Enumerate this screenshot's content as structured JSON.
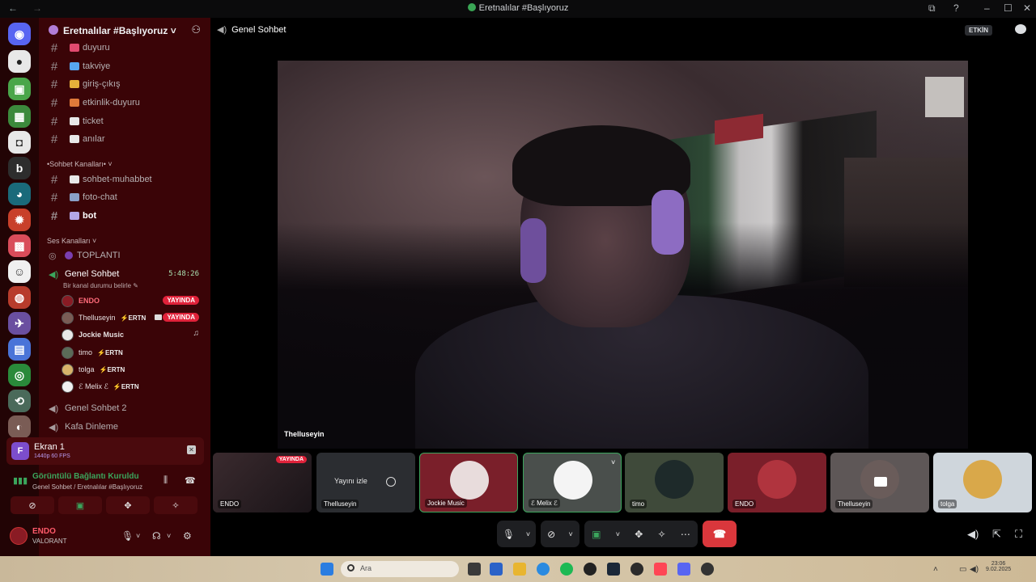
{
  "window": {
    "title": "Eretnalılar #Başlıyoruz"
  },
  "sidebar": {
    "guild_name": "Eretnalılar #Başlıyoruz ˅",
    "text_channels": [
      {
        "name": "duyuru",
        "emoji_color": "#e04a6e"
      },
      {
        "name": "takviye",
        "emoji_color": "#57a6f0"
      },
      {
        "name": "giriş-çıkış",
        "emoji_color": "#e6b03a"
      },
      {
        "name": "etkinlik-duyuru",
        "emoji_color": "#e07a3a"
      },
      {
        "name": "ticket",
        "emoji_color": "#e8e8e8"
      },
      {
        "name": "anılar",
        "emoji_color": "#e8e8e8"
      }
    ],
    "sohbet_category": "•Sohbet Kanalları• ˅",
    "sohbet_channels": [
      {
        "name": "sohbet-muhabbet",
        "emoji_color": "#e8e8e8"
      },
      {
        "name": "foto-chat",
        "emoji_color": "#8aa0c8"
      },
      {
        "name": "bot",
        "emoji_color": "#b3a6e6"
      }
    ],
    "voice_category": "Ses Kanalları ˅",
    "stage_channel": "TOPLANTI",
    "voice_channel": "Genel Sohbet",
    "voice_timer": "5:48:26",
    "voice_status": "Bir kanal durumu belirle ✎",
    "voice_users": [
      {
        "name": "ENDO",
        "tag": "",
        "live": "YAYINDA",
        "color": "#8a1b24"
      },
      {
        "name": "Thelluseyin",
        "tag": "⚡ERTN",
        "live": "YAYINDA",
        "color": "#7a5c55"
      },
      {
        "name": "Jockie Music",
        "tag": "",
        "live": "",
        "color": "#e8e8e8"
      },
      {
        "name": "timo",
        "tag": "⚡ERTN",
        "live": "",
        "color": "#5b6b57"
      },
      {
        "name": "tolga",
        "tag": "⚡ERTN",
        "live": "",
        "color": "#d8b36a"
      },
      {
        "name": "ℰ Melix ℰ",
        "tag": "⚡ERTN",
        "live": "",
        "color": "#f0f0f0"
      }
    ],
    "other_voice": [
      "Genel Sohbet 2",
      "Kafa Dinleme"
    ]
  },
  "stream_panel": {
    "letter": "F",
    "title": "Ekran 1",
    "quality": "1440p 60 FPS"
  },
  "connection": {
    "status": "Görüntülü Bağlantı Kuruldu",
    "location": "Genel Sohbet / Eretnalılar #Başlıyoruz"
  },
  "user": {
    "name": "ENDO",
    "status": "VALORANT"
  },
  "main": {
    "channel_title": "Genel Sohbet",
    "active_badge": "ETKİN",
    "focused_name": "Thelluseyin"
  },
  "tiles": [
    {
      "label": "ENDO",
      "badge": "YAYINDA",
      "bg": "#2a1a1c"
    },
    {
      "label": "Thelluseyin",
      "watch": "Yayını izle",
      "bg": "#2b2d31"
    },
    {
      "label": "Jockie Music",
      "bg": "#7a1f2a"
    },
    {
      "label": "ℰ Melix ℰ",
      "bg": "#4a4f4c"
    },
    {
      "label": "timo",
      "bg": "#3f4a3a"
    },
    {
      "label": "ENDO",
      "bg": "#7a1f2a"
    },
    {
      "label": "Thelluseyin",
      "bg": "#5e5757"
    },
    {
      "label": "tolga",
      "bg": "#cfd6dc"
    }
  ],
  "taskbar": {
    "search_placeholder": "Ara",
    "time": "23:06",
    "date": "9.02.2025"
  }
}
